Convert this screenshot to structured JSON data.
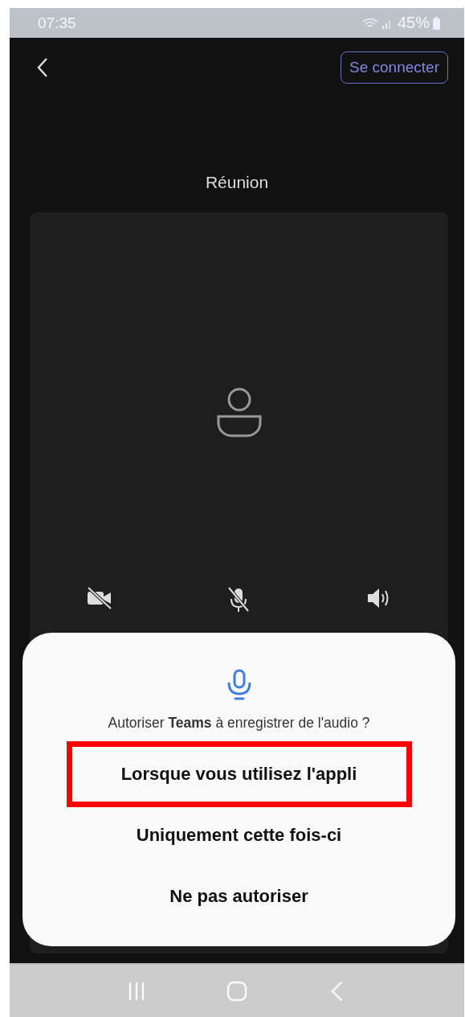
{
  "status_bar": {
    "time": "07:35",
    "battery": "45%"
  },
  "header": {
    "signin_button": "Se connecter"
  },
  "title": "Réunion",
  "controls": [
    {
      "kind": "camera",
      "off": true
    },
    {
      "kind": "mic",
      "off": true
    },
    {
      "kind": "speaker",
      "off": false
    }
  ],
  "permission_sheet": {
    "question": "Autoriser **Teams** à enregistrer de l'audio ?",
    "options": [
      {
        "label": "Lorsque vous utilisez l'appli",
        "highlighted": true
      },
      {
        "label": "Uniquement cette fois-ci",
        "highlighted": false
      },
      {
        "label": "Ne pas autoriser",
        "highlighted": false
      }
    ]
  }
}
